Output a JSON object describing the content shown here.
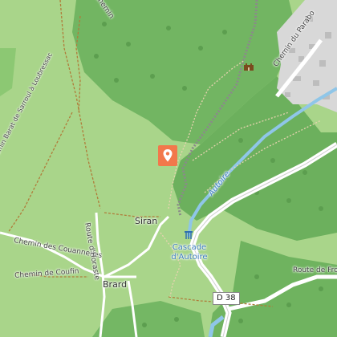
{
  "map": {
    "labels": {
      "chemin_du_parabo": "Chemin du Parabo",
      "chemin_barat": "Chemin Barat de Sarroul à Loubressac",
      "chemin_couannelles": "Chemin des Couannelles",
      "route_horaste": "Route d'Horaste",
      "chemin_coufin": "Chemin de Coufin",
      "route_frou": "Route de Frou",
      "top_chemin": "Chemin",
      "siran": "Siran",
      "brard": "Brard",
      "cascade": "Cascade d'Autoire",
      "autoire_river": "Autoire",
      "road_shield": "D 38"
    },
    "icons": {
      "location_marker": "map-pin-icon",
      "castle": "castle-icon",
      "waterfall": "waterfall-icon"
    },
    "colors": {
      "meadow": "#a9d58a",
      "forest": "#6fb35f",
      "river": "#8fc6e8",
      "village": "#dcdcdc",
      "marker": "#f2784b",
      "trail": "#b07c3a"
    }
  }
}
